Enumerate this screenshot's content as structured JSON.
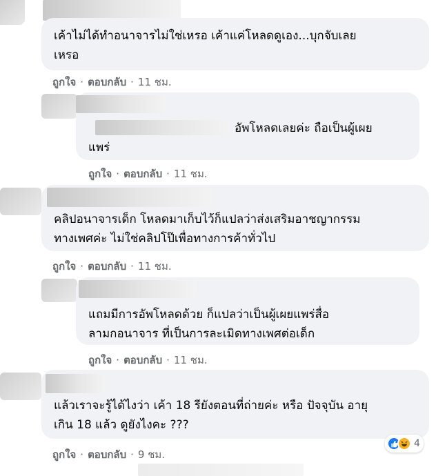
{
  "colors": {
    "bubble_bg": "#f0f2f5",
    "action_text": "#65676b",
    "like_blue": "#1877f2",
    "haha_yellow": "#f7b125"
  },
  "comments": [
    {
      "lines": [
        "เค้าไม่ได้ทำอนาจารไม่ใช่เหรอ เค้าแค่โหลดดูเอง...บุกจับเลย",
        "เหรอ"
      ],
      "like": "ถูกใจ",
      "reply": "ตอบกลับ",
      "time": "11 ชม."
    },
    {
      "lines": [
        "อัพโหลดเลยค่ะ ถือเป็นผู้เผย",
        "แพร่"
      ],
      "like": "ถูกใจ",
      "reply": "ตอบกลับ",
      "time": "11 ชม."
    },
    {
      "lines": [
        "คลิปอนาจารเด็ก โหลดมาเก็บไว้ก็แปลว่าส่งเสริมอาชญากรรม",
        "ทางเพศค่ะ ไม่ใช่คลิปโป๊เพื่อทางการค้าทั่วไป"
      ],
      "like": "ถูกใจ",
      "reply": "ตอบกลับ",
      "time": "11 ชม."
    },
    {
      "lines": [
        "แถมมีการอัพโหลดด้วย ก็แปลว่าเป็นผู้เผยแพร่สื่อ",
        "ลามกอนาจาร ที่เป็นการละเมิดทางเพศต่อเด็ก"
      ],
      "like": "ถูกใจ",
      "reply": "ตอบกลับ",
      "time": "11 ชม."
    },
    {
      "lines": [
        "แล้วเราจะรู้ได้ไงว่า เค้า 18 รียังตอนที่ถ่ายค่ะ หรือ ปัจจุบัน อายุ",
        "เกิน 18 แล้ว ดูยังไงคะ ???"
      ],
      "like": "ถูกใจ",
      "reply": "ตอบกลับ",
      "time": "9 ชม.",
      "reactions": {
        "icons": [
          "like-icon",
          "haha-icon"
        ],
        "count": "4"
      }
    }
  ]
}
